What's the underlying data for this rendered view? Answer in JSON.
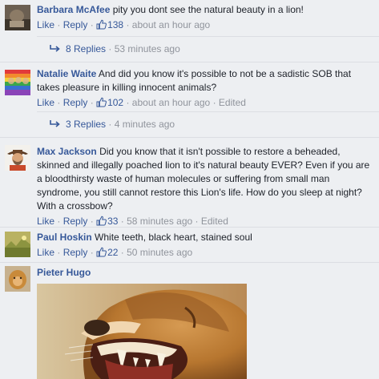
{
  "comments": [
    {
      "name": "Barbara McAfee",
      "text": "pity you dont see the natural beauty in a lion!",
      "like": "Like",
      "reply": "Reply",
      "likes": "138",
      "time": "about an hour ago",
      "replies": "8 Replies",
      "replies_time": "53 minutes ago"
    },
    {
      "name": "Natalie Waite",
      "text": "And did you know it's possible to not be a sadistic SOB that takes pleasure in killing innocent animals?",
      "like": "Like",
      "reply": "Reply",
      "likes": "102",
      "time": "about an hour ago",
      "edited": "Edited",
      "replies": "3 Replies",
      "replies_time": "4 minutes ago"
    },
    {
      "name": "Max Jackson",
      "text": "Did you know that it isn't possible to restore a beheaded, skinned and illegally poached lion to it's natural beauty EVER? Even if you are a bloodthirsty waste of human molecules or suffering from small man syndrome, you still cannot restore this Lion's life. How do you sleep at night? With a crossbow?",
      "like": "Like",
      "reply": "Reply",
      "likes": "33",
      "time": "58 minutes ago",
      "edited": "Edited"
    },
    {
      "name": "Paul Hoskin",
      "text": "White teeth, black heart, stained soul",
      "like": "Like",
      "reply": "Reply",
      "likes": "22",
      "time": "50 minutes ago"
    },
    {
      "name": "Pieter Hugo"
    }
  ],
  "separator": "·",
  "colors": {
    "link": "#365899",
    "meta": "#90949c",
    "background": "#edeff2"
  },
  "icons": {
    "like": "thumbs-up-icon",
    "replies": "reply-arrow-icon"
  }
}
